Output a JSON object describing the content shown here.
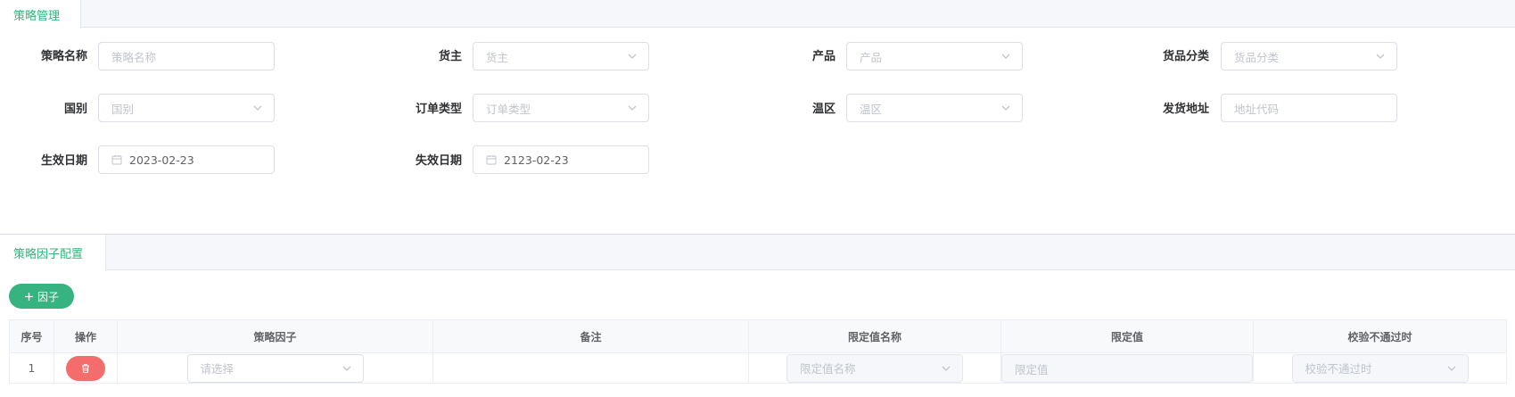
{
  "tabs": {
    "strategy_management": "策略管理",
    "factor_config": "策略因子配置"
  },
  "form": {
    "strategy_name": {
      "label": "策略名称",
      "placeholder": "策略名称"
    },
    "owner": {
      "label": "货主",
      "placeholder": "货主"
    },
    "product": {
      "label": "产品",
      "placeholder": "产品"
    },
    "goods_category": {
      "label": "货品分类",
      "placeholder": "货品分类"
    },
    "country": {
      "label": "国别",
      "placeholder": "国别"
    },
    "order_type": {
      "label": "订单类型",
      "placeholder": "订单类型"
    },
    "temp_zone": {
      "label": "温区",
      "placeholder": "温区"
    },
    "ship_address": {
      "label": "发货地址",
      "placeholder": "地址代码"
    },
    "effective_date": {
      "label": "生效日期",
      "value": "2023-02-23"
    },
    "expiry_date": {
      "label": "失效日期",
      "value": "2123-02-23"
    }
  },
  "toolbar": {
    "add_factor_label": "因子",
    "add_icon": "plus-icon"
  },
  "table": {
    "headers": [
      "序号",
      "操作",
      "策略因子",
      "备注",
      "限定值名称",
      "限定值",
      "校验不通过时"
    ],
    "rows": [
      {
        "index": "1",
        "delete_icon": "trash-icon",
        "factor_placeholder": "请选择",
        "remark": "",
        "limit_name_placeholder": "限定值名称",
        "limit_value_placeholder": "限定值",
        "on_fail_placeholder": "校验不通过时"
      }
    ]
  },
  "colors": {
    "accent": "#36b37e",
    "danger": "#f56c6c",
    "border": "#dcdfe6",
    "tab_bg": "#f5f7fa"
  }
}
